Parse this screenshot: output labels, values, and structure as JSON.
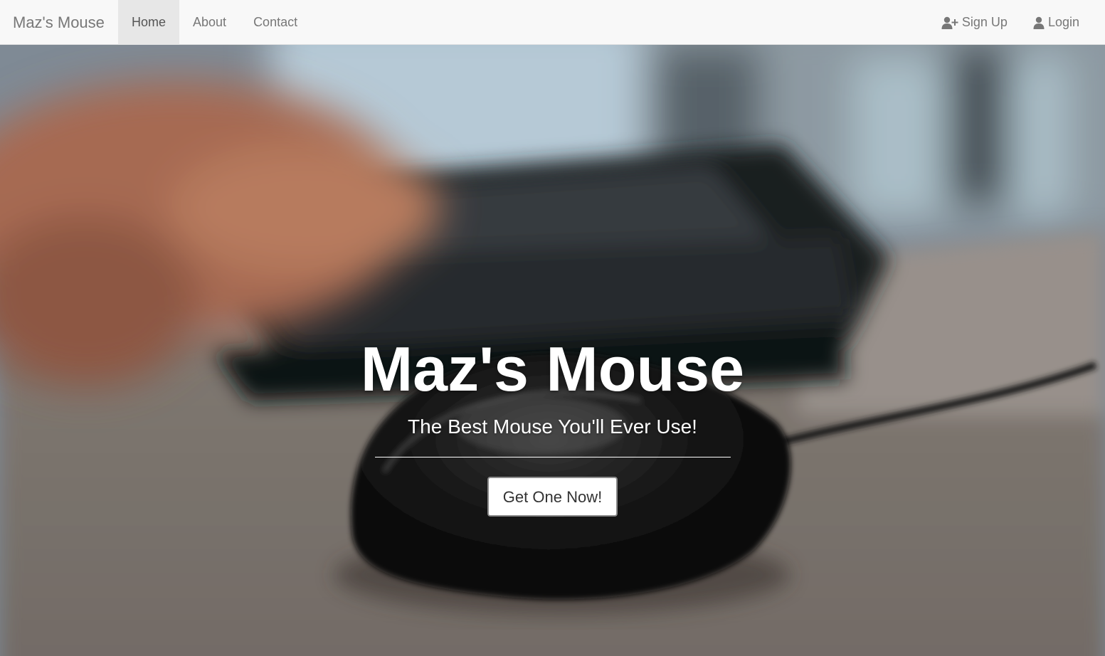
{
  "navbar": {
    "brand": "Maz's Mouse",
    "left_items": [
      {
        "label": "Home",
        "active": true
      },
      {
        "label": "About",
        "active": false
      },
      {
        "label": "Contact",
        "active": false
      }
    ],
    "right_items": [
      {
        "label": "Sign Up",
        "icon": "user-plus-icon"
      },
      {
        "label": "Login",
        "icon": "user-icon"
      }
    ]
  },
  "hero": {
    "title": "Maz's Mouse",
    "subtitle": "The Best Mouse You'll Ever Use!",
    "cta_label": "Get One Now!"
  },
  "colors": {
    "navbar_bg": "#f8f8f8",
    "nav_text": "#777777",
    "nav_active_bg": "#e7e7e7",
    "hero_text": "#ffffff",
    "button_bg": "#ffffff",
    "button_text": "#333333"
  }
}
